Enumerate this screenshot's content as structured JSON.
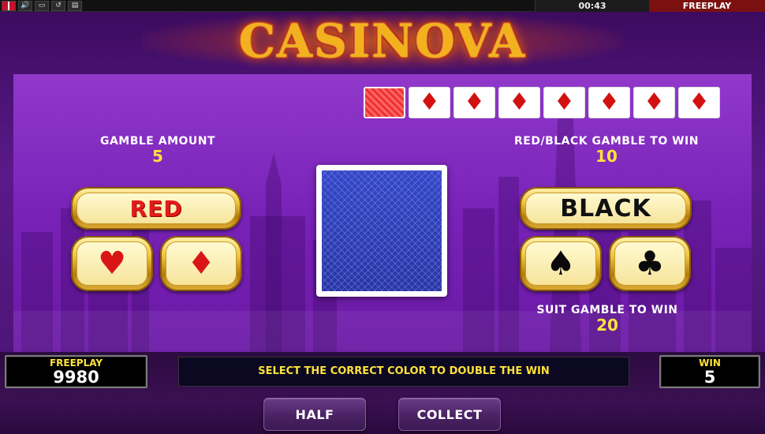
{
  "topbar": {
    "icons": [
      "uk-flag-icon",
      "speaker-icon",
      "fullscreen-icon",
      "history-icon",
      "help-icon"
    ],
    "time": "00:43",
    "mode": "FREEPLAY"
  },
  "logo": {
    "text": "CASINOVA"
  },
  "history": {
    "cards": [
      "back",
      "diamond",
      "diamond",
      "diamond",
      "diamond",
      "diamond",
      "diamond",
      "diamond"
    ],
    "diamond_symbol": "♦"
  },
  "gamble_amount": {
    "label": "GAMBLE AMOUNT",
    "value": "5"
  },
  "color_gamble": {
    "label": "RED/BLACK GAMBLE TO WIN",
    "value": "10"
  },
  "suit_gamble": {
    "label": "SUIT GAMBLE TO WIN",
    "value": "20"
  },
  "buttons": {
    "red": "RED",
    "black": "BLACK",
    "hearts": "♥",
    "diamonds": "♦",
    "spades": "♠",
    "clubs": "♣",
    "half": "HALF",
    "collect": "COLLECT"
  },
  "footer": {
    "balance_label": "FREEPLAY",
    "balance_value": "9980",
    "message": "SELECT THE CORRECT COLOR TO DOUBLE THE WIN",
    "win_label": "WIN",
    "win_value": "5"
  },
  "colors": {
    "accent_yellow": "#ffe23a",
    "gold": "#f2c640",
    "red": "#e31b1b",
    "panel_purple": "#8a2fc6"
  }
}
